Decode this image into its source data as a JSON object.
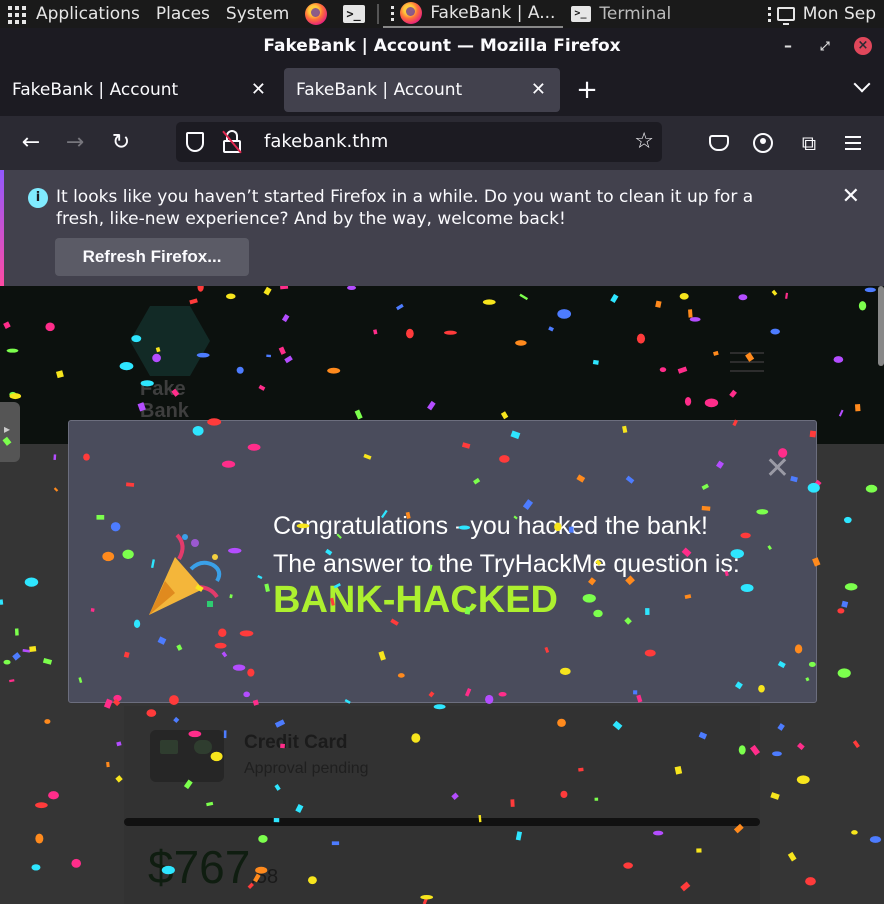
{
  "top_panel": {
    "applications": "Applications",
    "places": "Places",
    "system": "System",
    "task_firefox": "FakeBank | A...",
    "task_terminal": "Terminal",
    "clock": "Mon Sep"
  },
  "browser": {
    "window_title": "FakeBank | Account — Mozilla Firefox",
    "tabs": [
      {
        "label": "FakeBank | Account"
      },
      {
        "label": "FakeBank | Account"
      }
    ],
    "url": "fakebank.thm",
    "notification": {
      "text": "It looks like you haven’t started Firefox in a while. Do you want to clean it up for a fresh, like-new experience? And by the way, welcome back!",
      "button": "Refresh Firefox..."
    }
  },
  "page": {
    "logo_line1": "Fake",
    "logo_line2": "Bank",
    "modal": {
      "line1": "Congratulations - you hacked the bank!",
      "line2": "The answer to the TryHackMe question is:",
      "answer": "BANK-HACKED"
    },
    "card": {
      "title": "Credit Card",
      "status": "Approval pending",
      "balance": "$767",
      "cents": ".58"
    }
  },
  "colors": {
    "answer": "#adf02f",
    "modal_bg": "#4a4c5c",
    "chrome_dark": "#1c1b22"
  }
}
